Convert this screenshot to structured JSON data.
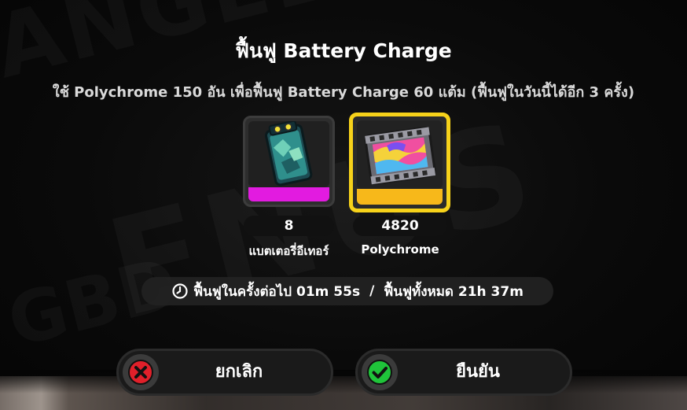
{
  "dialog": {
    "title": "ฟื้นฟู Battery Charge",
    "description": "ใช้ Polychrome 150 อัน เพื่อฟื้นฟู Battery Charge 60 แต้ม (ฟื้นฟูในวันนี้ได้อีก 3 ครั้ง)"
  },
  "items": [
    {
      "icon": "battery-item-icon",
      "count": "8",
      "name": "แบตเตอรี่อีเทอร์",
      "rarity_color": "#e21be0"
    },
    {
      "icon": "polychrome-item-icon",
      "count": "4820",
      "name": "Polychrome",
      "rarity_color": "#f7b81a",
      "selected_border_color": "#f7d21a"
    }
  ],
  "timer": {
    "icon": "clock-icon",
    "next_label": "ฟื้นฟูในครั้งต่อไป 01m  55s",
    "separator": "/",
    "full_label": "ฟื้นฟูทั้งหมด 21h   37m"
  },
  "buttons": {
    "cancel": {
      "label": "ยกเลิก",
      "icon": "close-circle-icon",
      "icon_color": "#e0202a"
    },
    "confirm": {
      "label": "ยืนยัน",
      "icon": "check-circle-icon",
      "icon_color": "#1fc43a"
    }
  }
}
